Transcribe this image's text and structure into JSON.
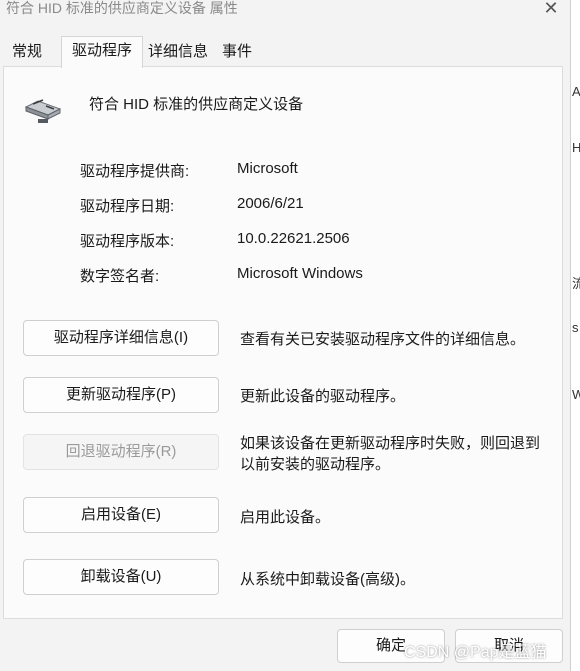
{
  "window": {
    "title": "符合 HID 标准的供应商定义设备 属性",
    "close_glyph": "✕"
  },
  "tabs": [
    {
      "label": "常规",
      "active": false
    },
    {
      "label": "驱动程序",
      "active": true
    },
    {
      "label": "详细信息",
      "active": false
    },
    {
      "label": "事件",
      "active": false
    }
  ],
  "device": {
    "name": "符合 HID 标准的供应商定义设备",
    "icon": "hid-device-icon"
  },
  "driver_info": {
    "provider_label": "驱动程序提供商:",
    "provider_value": "Microsoft",
    "date_label": "驱动程序日期:",
    "date_value": "2006/6/21",
    "version_label": "驱动程序版本:",
    "version_value": "10.0.22621.2506",
    "signer_label": "数字签名者:",
    "signer_value": "Microsoft Windows"
  },
  "actions": [
    {
      "label": "驱动程序详细信息(I)",
      "description": "查看有关已安装驱动程序文件的详细信息。",
      "enabled": true
    },
    {
      "label": "更新驱动程序(P)",
      "description": "更新此设备的驱动程序。",
      "enabled": true
    },
    {
      "label": "回退驱动程序(R)",
      "description": "如果该设备在更新驱动程序时失败，则回退到以前安装的驱动程序。",
      "enabled": false
    },
    {
      "label": "启用设备(E)",
      "description": "启用此设备。",
      "enabled": true
    },
    {
      "label": "卸载设备(U)",
      "description": "从系统中卸载设备(高级)。",
      "enabled": true
    }
  ],
  "footer": {
    "ok_label": "确定",
    "cancel_label": "取消"
  },
  "watermark": "CSDN @Pap是蓝猫",
  "background_window": {
    "fragments": [
      "A",
      "H",
      "流",
      "s",
      "W"
    ]
  },
  "colors": {
    "panel_bg": "#fbfbfb",
    "window_bg": "#f3f3f3",
    "disabled_text": "#9a9a9a",
    "border": "#cfcfcf"
  }
}
